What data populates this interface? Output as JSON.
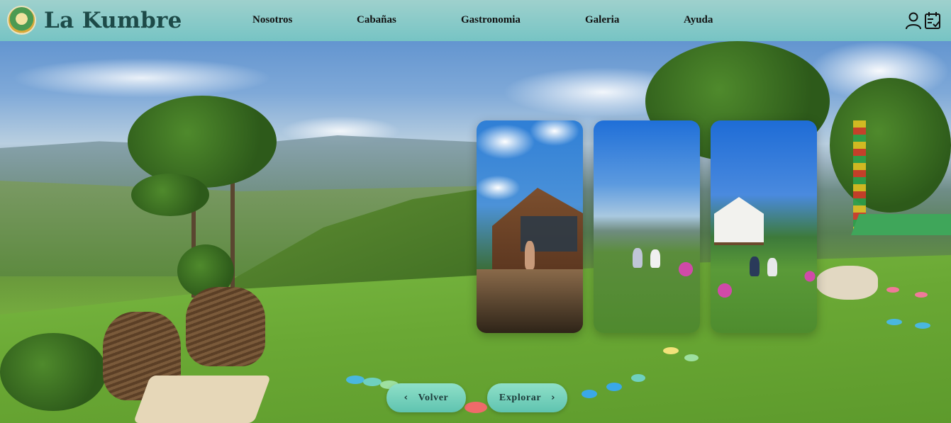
{
  "brand": {
    "name": "La Kumbre",
    "logo_icon": "logo-emblem-icon"
  },
  "nav": {
    "links": [
      {
        "label": "Nosotros"
      },
      {
        "label": "Cabañas"
      },
      {
        "label": "Gastronomia"
      },
      {
        "label": "Galeria"
      },
      {
        "label": "Ayuda"
      }
    ],
    "icons": [
      "user-icon",
      "calendar-check-icon"
    ]
  },
  "carousel": {
    "cards": [
      {
        "name": "gallery-card-cabin"
      },
      {
        "name": "gallery-card-view"
      },
      {
        "name": "gallery-card-cottage"
      }
    ],
    "back_label": "Volver",
    "explore_label": "Explorar",
    "back_icon": "‹",
    "explore_icon": "›"
  },
  "colors": {
    "navbar": "#86cfc4",
    "brand_text": "#1d4a48",
    "button": "#6fcab7"
  }
}
